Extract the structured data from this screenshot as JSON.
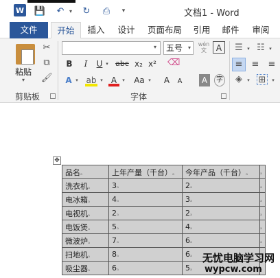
{
  "window": {
    "title": "文档1 - Word"
  },
  "tabs": [
    {
      "id": "file",
      "label": "文件"
    },
    {
      "id": "home",
      "label": "开始",
      "active": true
    },
    {
      "id": "insert",
      "label": "插入"
    },
    {
      "id": "design",
      "label": "设计"
    },
    {
      "id": "layout",
      "label": "页面布局"
    },
    {
      "id": "references",
      "label": "引用"
    },
    {
      "id": "mailings",
      "label": "邮件"
    },
    {
      "id": "review",
      "label": "审阅"
    }
  ],
  "ribbon": {
    "paste_label": "粘贴",
    "clipboard_label": "剪贴板",
    "font_group_label": "字体",
    "font_name": "",
    "font_size": "五号",
    "wen": "wén\n文",
    "bold": "B",
    "italic": "I",
    "underline": "U",
    "strike": "abc",
    "subscript": "x₂",
    "superscript": "x²",
    "font_grow": "A",
    "font_shrink": "A",
    "change_case": "Aa",
    "char_border": "A",
    "char_shade": "A",
    "enclosed": "字"
  },
  "table": {
    "headers": [
      "品名",
      "上年产量（千台）",
      "今年产品（千台）"
    ],
    "rows": [
      [
        "洗衣机",
        "3",
        "2"
      ],
      [
        "电冰箱",
        "4",
        "3"
      ],
      [
        "电视机",
        "2",
        "2"
      ],
      [
        "电饭煲",
        "5",
        "4"
      ],
      [
        "微波炉",
        "7",
        "6"
      ],
      [
        "扫地机",
        "8",
        "6"
      ],
      [
        "吸尘器",
        "6",
        "5"
      ]
    ],
    "cell_mark": "ₐ"
  },
  "watermark": {
    "name": "无忧电脑学习网",
    "url": "wypcw.com"
  },
  "colors": {
    "accent": "#2b579a",
    "ribbon_bg": "#f3f3f3",
    "cell_shade": "#d0d0d0"
  }
}
